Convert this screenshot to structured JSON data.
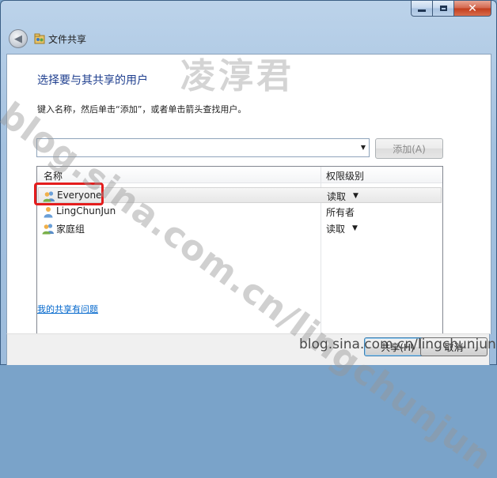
{
  "window": {
    "title": "文件共享",
    "back_icon": "back-arrow-icon"
  },
  "content": {
    "heading": "选择要与其共享的用户",
    "instruction": "键入名称，然后单击“添加”，或者单击箭头查找用户。",
    "user_input": {
      "value": "",
      "placeholder": ""
    },
    "add_button": "添加(A)"
  },
  "list": {
    "columns": [
      "名称",
      "权限级别"
    ],
    "rows": [
      {
        "name": "Everyone",
        "permission": "读取",
        "icon": "users-group-icon",
        "has_dropdown": true,
        "selected": true
      },
      {
        "name": "LingChunJun",
        "permission": "所有者",
        "icon": "user-icon",
        "has_dropdown": false,
        "selected": false
      },
      {
        "name": "家庭组",
        "permission": "读取",
        "icon": "users-group-icon",
        "has_dropdown": true,
        "selected": false
      }
    ]
  },
  "help_link": "我的共享有问题",
  "footer": {
    "share_button": "共享(H)",
    "cancel_button": "取消"
  },
  "watermarks": {
    "diagonal": "blog.sina.com.cn/lingchunjun",
    "top": "凌淳君",
    "bottom": "blog.sina.com.cn/lingchunjun"
  },
  "colors": {
    "heading": "#1f3f8f",
    "link": "#0066cc",
    "highlight": "#e41d1d"
  }
}
